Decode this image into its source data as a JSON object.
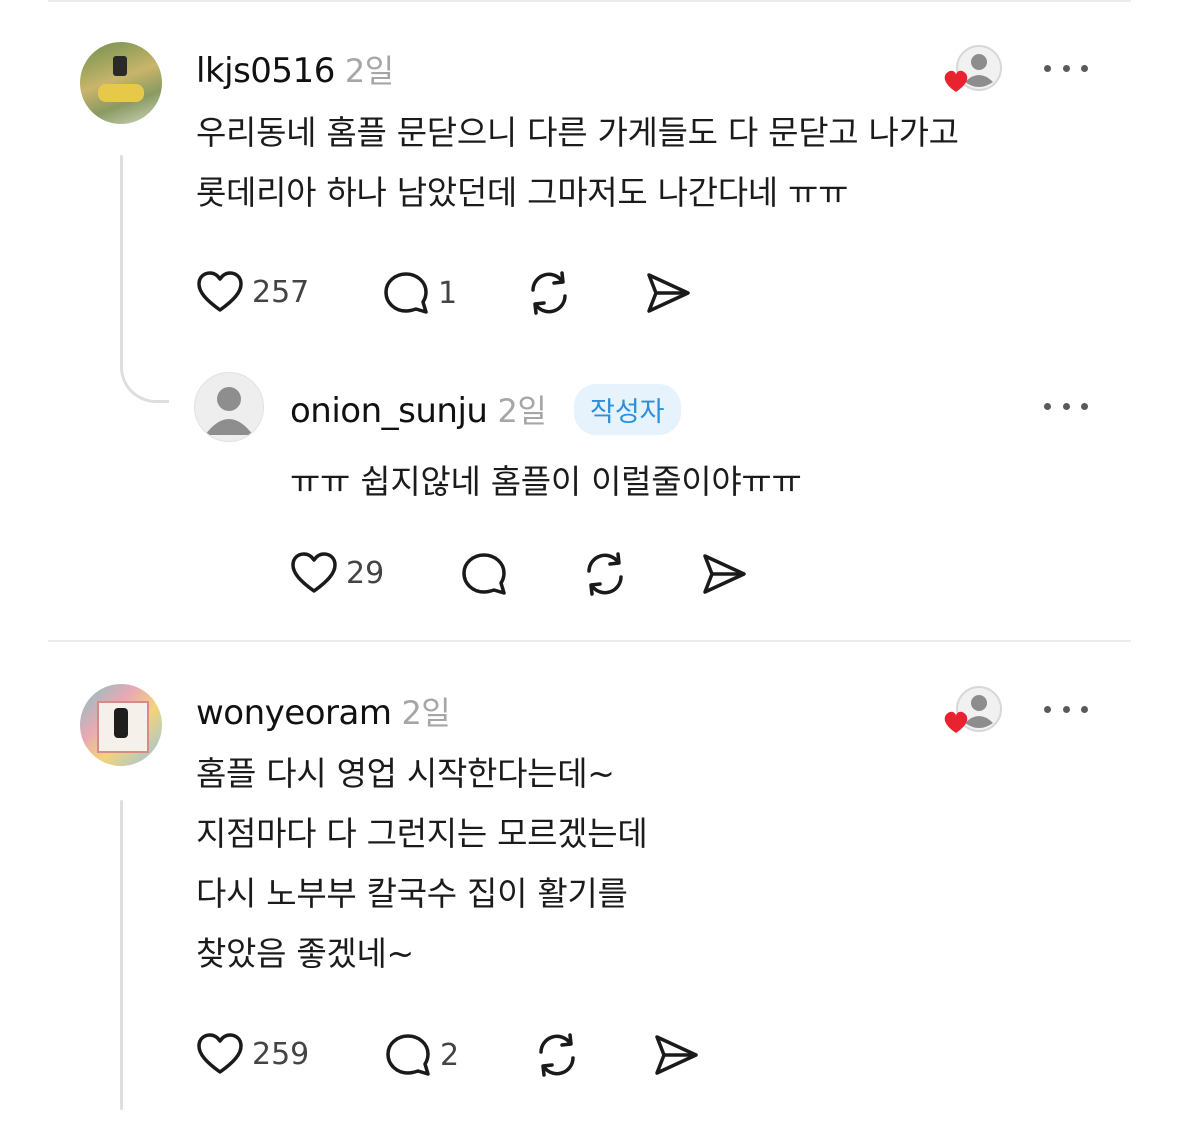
{
  "comments": [
    {
      "username": "lkjs0516",
      "time": "2일",
      "lines": [
        "우리동네 홈플 문닫으니 다른 가게들도 다 문닫고 나가고",
        "롯데리아 하나 남았던데 그마저도 나간다네 ㅠㅠ"
      ],
      "likes": "257",
      "replies": "1",
      "liked_by_author_icon": "heart-avatar-icon",
      "reply": {
        "username": "onion_sunju",
        "time": "2일",
        "badge": "작성자",
        "text": "ㅠㅠ 쉽지않네 홈플이 이럴줄이야ㅠㅠ",
        "likes": "29"
      }
    },
    {
      "username": "wonyeoram",
      "time": "2일",
      "lines": [
        "홈플 다시 영업 시작한다는데~",
        "지점마다 다 그런지는 모르겠는데",
        "다시  노부부 칼국수 집이 활기를",
        "찾았음  좋겠네~"
      ],
      "likes": "259",
      "replies": "2",
      "liked_by_author_icon": "heart-avatar-icon"
    }
  ],
  "colors": {
    "heart": "#e8232f",
    "badge_bg": "#e6f3fd",
    "badge_text": "#2b8fdb",
    "muted": "#a6a6a6"
  }
}
